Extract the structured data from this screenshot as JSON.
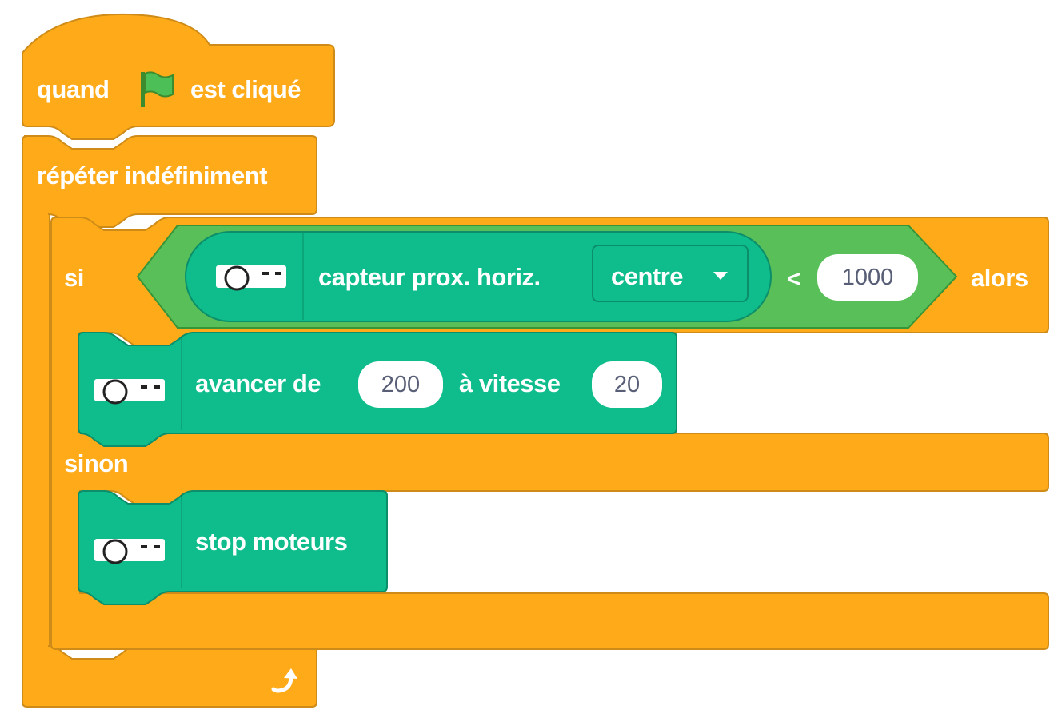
{
  "hat_block": {
    "text_before": "quand",
    "flag_icon": "green-flag-icon",
    "text_after": "est cliqué"
  },
  "forever_block": {
    "label": "répéter indéfiniment",
    "loop_icon": "loop-arrow-icon"
  },
  "if_else_block": {
    "if_label": "si",
    "then_label": "alors",
    "else_label": "sinon"
  },
  "condition": {
    "sensor_label": "capteur prox. horiz.",
    "dropdown_value": "centre",
    "operator": "<",
    "value": "1000"
  },
  "move_block": {
    "text_1": "avancer de",
    "distance": "200",
    "text_2": "à vitesse",
    "speed": "20"
  },
  "stop_block": {
    "label": "stop moteurs"
  },
  "icons": {
    "robot": "robot-icon",
    "dropdown": "triangle-down-icon"
  },
  "colors": {
    "control": "#FFAB19",
    "control_dark": "#CF8B17",
    "robot_block": "#0FBD8C",
    "robot_block_dark": "#0B8E69",
    "operator": "#59C059",
    "operator_dark": "#389438"
  }
}
